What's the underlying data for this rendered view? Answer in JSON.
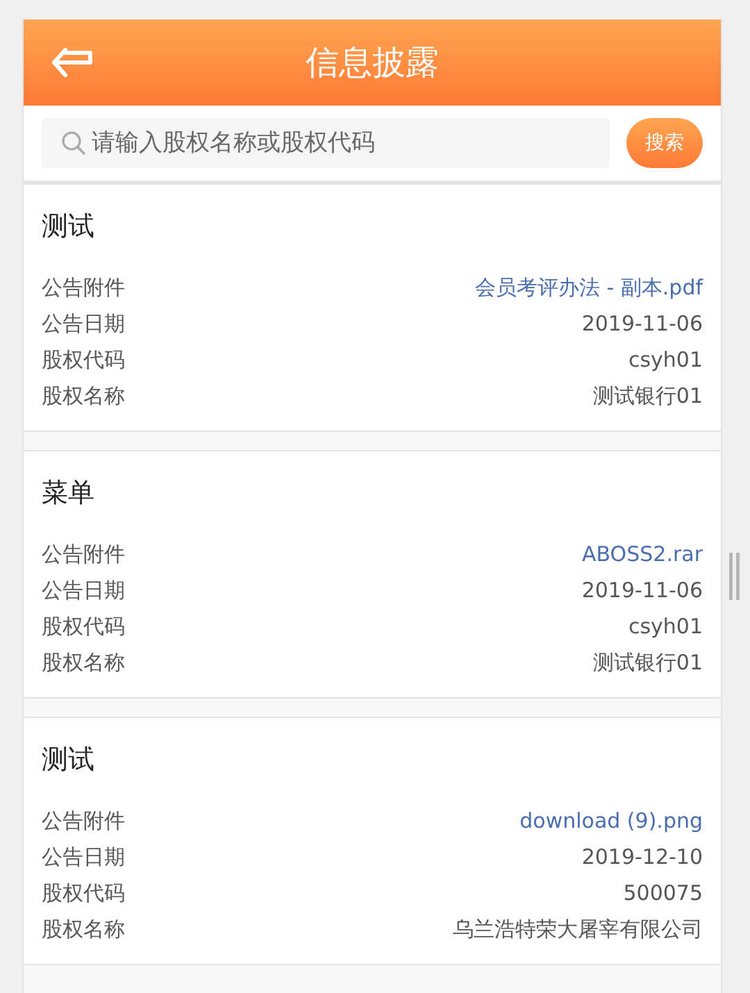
{
  "header": {
    "title": "信息披露"
  },
  "search": {
    "placeholder": "请输入股权名称或股权代码",
    "button": "搜索"
  },
  "cards": [
    {
      "title": "测试",
      "fields": [
        {
          "label": "公告附件",
          "value": "会员考评办法 - 副本.pdf",
          "kind": "link"
        },
        {
          "label": "公告日期",
          "value": "2019-11-06",
          "kind": "text"
        },
        {
          "label": "股权代码",
          "value": "csyh01",
          "kind": "text"
        },
        {
          "label": "股权名称",
          "value": "测试银行01",
          "kind": "text"
        }
      ]
    },
    {
      "title": "菜单",
      "fields": [
        {
          "label": "公告附件",
          "value": "ABOSS2.rar",
          "kind": "link"
        },
        {
          "label": "公告日期",
          "value": "2019-11-06",
          "kind": "text"
        },
        {
          "label": "股权代码",
          "value": "csyh01",
          "kind": "text"
        },
        {
          "label": "股权名称",
          "value": "测试银行01",
          "kind": "text"
        }
      ]
    },
    {
      "title": "测试",
      "fields": [
        {
          "label": "公告附件",
          "value": "download (9).png",
          "kind": "link"
        },
        {
          "label": "公告日期",
          "value": "2019-12-10",
          "kind": "text"
        },
        {
          "label": "股权代码",
          "value": "500075",
          "kind": "text"
        },
        {
          "label": "股权名称",
          "value": "乌兰浩特荣大屠宰有限公司",
          "kind": "text"
        }
      ]
    }
  ]
}
